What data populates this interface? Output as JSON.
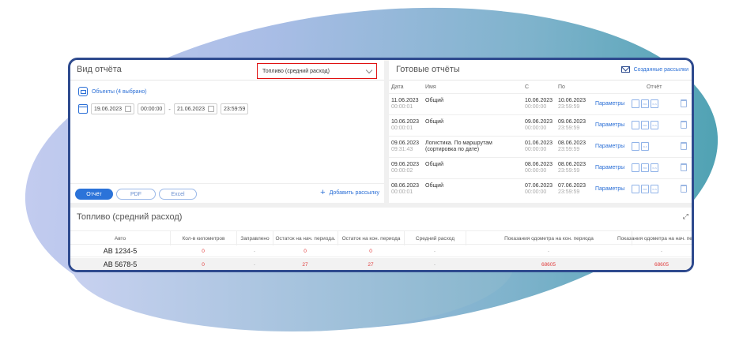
{
  "left": {
    "title": "Вид отчёта",
    "report_type": "Топливо (средний расход)",
    "objects_label": "Объекты (4 выбрано)",
    "date_from": "19.06.2023",
    "time_from": "00:00:00",
    "date_to": "21.06.2023",
    "time_to": "23:59:59",
    "btn_report": "Отчёт",
    "btn_pdf": "PDF",
    "btn_excel": "Excel",
    "add_subscription": "Добавить рассылку"
  },
  "right": {
    "title": "Готовые отчёты",
    "created_subscriptions": "Созданные рассылки",
    "columns": {
      "date": "Дата",
      "name": "Имя",
      "from": "С",
      "to": "По",
      "report": "Отчёт"
    },
    "params_label": "Параметры",
    "rows": [
      {
        "date": "11.06.2023",
        "time": "00:00:01",
        "name": "Общий",
        "from_date": "10.06.2023",
        "from_time": "00:00:00",
        "to_date": "10.06.2023",
        "to_time": "23:59:59",
        "files": [
          "PDF",
          "XLS"
        ]
      },
      {
        "date": "10.06.2023",
        "time": "00:00:01",
        "name": "Общий",
        "from_date": "09.06.2023",
        "from_time": "00:00:00",
        "to_date": "09.06.2023",
        "to_time": "23:59:59",
        "files": [
          "PDF",
          "XLS"
        ]
      },
      {
        "date": "09.06.2023",
        "time": "09:31:43",
        "name": "Логистика. По маршрутам (сортировка по дате)",
        "from_date": "01.06.2023",
        "from_time": "00:00:00",
        "to_date": "08.06.2023",
        "to_time": "23:59:59",
        "files": [
          "XLS"
        ]
      },
      {
        "date": "09.06.2023",
        "time": "00:00:02",
        "name": "Общий",
        "from_date": "08.06.2023",
        "from_time": "00:00:00",
        "to_date": "08.06.2023",
        "to_time": "23:59:59",
        "files": [
          "PDF",
          "XLS"
        ]
      },
      {
        "date": "08.06.2023",
        "time": "00:00:01",
        "name": "Общий",
        "from_date": "07.06.2023",
        "from_time": "00:00:00",
        "to_date": "07.06.2023",
        "to_time": "23:59:59",
        "files": [
          "PDF",
          "XLS"
        ]
      }
    ]
  },
  "bottom": {
    "title": "Топливо (средний расход)",
    "columns": [
      "Авто",
      "Кол-в километров",
      "Заправлено",
      "Остаток на нач. периода.",
      "Остаток на кон. периода",
      "Средний расход",
      "Показания одометра на кон. периода",
      "Показания одометра на нач. периода"
    ],
    "rows": [
      [
        "АВ 1234-5",
        "0",
        "-",
        "0",
        "0",
        "-",
        "-",
        "-"
      ],
      [
        "АВ 5678-5",
        "0",
        "-",
        "27",
        "27",
        "-",
        "68605",
        "68605"
      ]
    ]
  }
}
